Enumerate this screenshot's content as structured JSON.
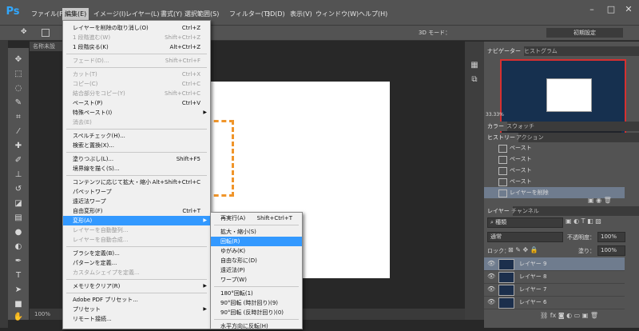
{
  "app": {
    "logo": "Ps"
  },
  "menubar": {
    "items": [
      "ファイル(F)",
      "編集(E)",
      "イメージ(I)",
      "レイヤー(L)",
      "書式(Y)",
      "選択範囲(S)",
      "フィルター(T)",
      "3D(D)",
      "表示(V)",
      "ウィンドウ(W)",
      "ヘルプ(H)"
    ],
    "active": "編集(E)"
  },
  "options": {
    "mode3d": "3D モード：",
    "workspace": "初期設定"
  },
  "document": {
    "tab": "名称未設",
    "zoom": "100%"
  },
  "edit_menu": {
    "items": [
      {
        "label": "レイヤーを削除の取り消し(O)",
        "shortcut": "Ctrl+Z",
        "state": "normal"
      },
      {
        "label": "1 段階進む(W)",
        "shortcut": "Shift+Ctrl+Z",
        "state": "disabled"
      },
      {
        "label": "1 段階戻る(K)",
        "shortcut": "Alt+Ctrl+Z",
        "state": "normal"
      },
      {
        "sep": true
      },
      {
        "label": "フェード(D)...",
        "shortcut": "Shift+Ctrl+F",
        "state": "disabled"
      },
      {
        "sep": true
      },
      {
        "label": "カット(T)",
        "shortcut": "Ctrl+X",
        "state": "disabled"
      },
      {
        "label": "コピー(C)",
        "shortcut": "Ctrl+C",
        "state": "disabled"
      },
      {
        "label": "結合部分をコピー(Y)",
        "shortcut": "Shift+Ctrl+C",
        "state": "disabled"
      },
      {
        "label": "ペースト(P)",
        "shortcut": "Ctrl+V",
        "state": "normal"
      },
      {
        "label": "特殊ペースト(I)",
        "shortcut": "",
        "state": "normal",
        "submenu": true
      },
      {
        "label": "消去(E)",
        "shortcut": "",
        "state": "disabled"
      },
      {
        "sep": true
      },
      {
        "label": "スペルチェック(H)...",
        "shortcut": "",
        "state": "normal"
      },
      {
        "label": "検索と置換(X)...",
        "shortcut": "",
        "state": "normal"
      },
      {
        "sep": true
      },
      {
        "label": "塗りつぶし(L)...",
        "shortcut": "Shift+F5",
        "state": "normal"
      },
      {
        "label": "境界線を描く(S)...",
        "shortcut": "",
        "state": "normal"
      },
      {
        "sep": true
      },
      {
        "label": "コンテンツに応じて拡大・縮小",
        "shortcut": "Alt+Shift+Ctrl+C",
        "state": "normal"
      },
      {
        "label": "パペットワープ",
        "shortcut": "",
        "state": "normal"
      },
      {
        "label": "遠近法ワープ",
        "shortcut": "",
        "state": "normal"
      },
      {
        "label": "自由変形(F)",
        "shortcut": "Ctrl+T",
        "state": "normal"
      },
      {
        "label": "変形(A)",
        "shortcut": "",
        "state": "highlight",
        "submenu": true
      },
      {
        "label": "レイヤーを自動整列...",
        "shortcut": "",
        "state": "disabled"
      },
      {
        "label": "レイヤーを自動合成...",
        "shortcut": "",
        "state": "disabled"
      },
      {
        "sep": true
      },
      {
        "label": "ブラシを定義(B)...",
        "shortcut": "",
        "state": "normal"
      },
      {
        "label": "パターンを定義...",
        "shortcut": "",
        "state": "normal"
      },
      {
        "label": "カスタムシェイプを定義...",
        "shortcut": "",
        "state": "disabled"
      },
      {
        "sep": true
      },
      {
        "label": "メモリをクリア(R)",
        "shortcut": "",
        "state": "normal",
        "submenu": true
      },
      {
        "sep": true
      },
      {
        "label": "Adobe PDF プリセット...",
        "shortcut": "",
        "state": "normal"
      },
      {
        "label": "プリセット",
        "shortcut": "",
        "state": "normal",
        "submenu": true
      },
      {
        "label": "リモート接続...",
        "shortcut": "",
        "state": "normal"
      }
    ]
  },
  "transform_submenu": {
    "items": [
      {
        "label": "再実行(A)",
        "shortcut": "Shift+Ctrl+T",
        "state": "normal"
      },
      {
        "sep": true
      },
      {
        "label": "拡大・縮小(S)",
        "shortcut": "",
        "state": "normal"
      },
      {
        "label": "回転(R)",
        "shortcut": "",
        "state": "highlight"
      },
      {
        "label": "ゆがみ(K)",
        "shortcut": "",
        "state": "normal"
      },
      {
        "label": "自由な形に(D)",
        "shortcut": "",
        "state": "normal"
      },
      {
        "label": "遠近法(P)",
        "shortcut": "",
        "state": "normal"
      },
      {
        "label": "ワープ(W)",
        "shortcut": "",
        "state": "normal"
      },
      {
        "sep": true
      },
      {
        "label": "180°回転(1)",
        "shortcut": "",
        "state": "normal"
      },
      {
        "label": "90°回転 (時計回り)(9)",
        "shortcut": "",
        "state": "normal"
      },
      {
        "label": "90°回転 (反時計回り)(0)",
        "shortcut": "",
        "state": "normal"
      },
      {
        "sep": true
      },
      {
        "label": "水平方向に反転(H)",
        "shortcut": "",
        "state": "normal"
      }
    ]
  },
  "panels": {
    "navigator_tabs": [
      "ナビゲーター",
      "ヒストグラム"
    ],
    "nav_zoom": "33.33%",
    "color_tabs": [
      "カラー",
      "スウォッチ"
    ],
    "history_tabs": [
      "ヒストリー",
      "アクション"
    ],
    "history": [
      "ペースト",
      "ペースト",
      "ペースト",
      "ペースト",
      "レイヤーを削除"
    ],
    "layers_tabs": [
      "レイヤー",
      "チャンネル"
    ],
    "kind_label": "種類",
    "blend_mode": "通常",
    "opacity_label": "不透明度：",
    "opacity": "100%",
    "lock_label": "ロック：",
    "fill_label": "塗り：",
    "fill": "100%",
    "layers": [
      "レイヤー 9",
      "レイヤー 8",
      "レイヤー 7",
      "レイヤー 6"
    ]
  }
}
